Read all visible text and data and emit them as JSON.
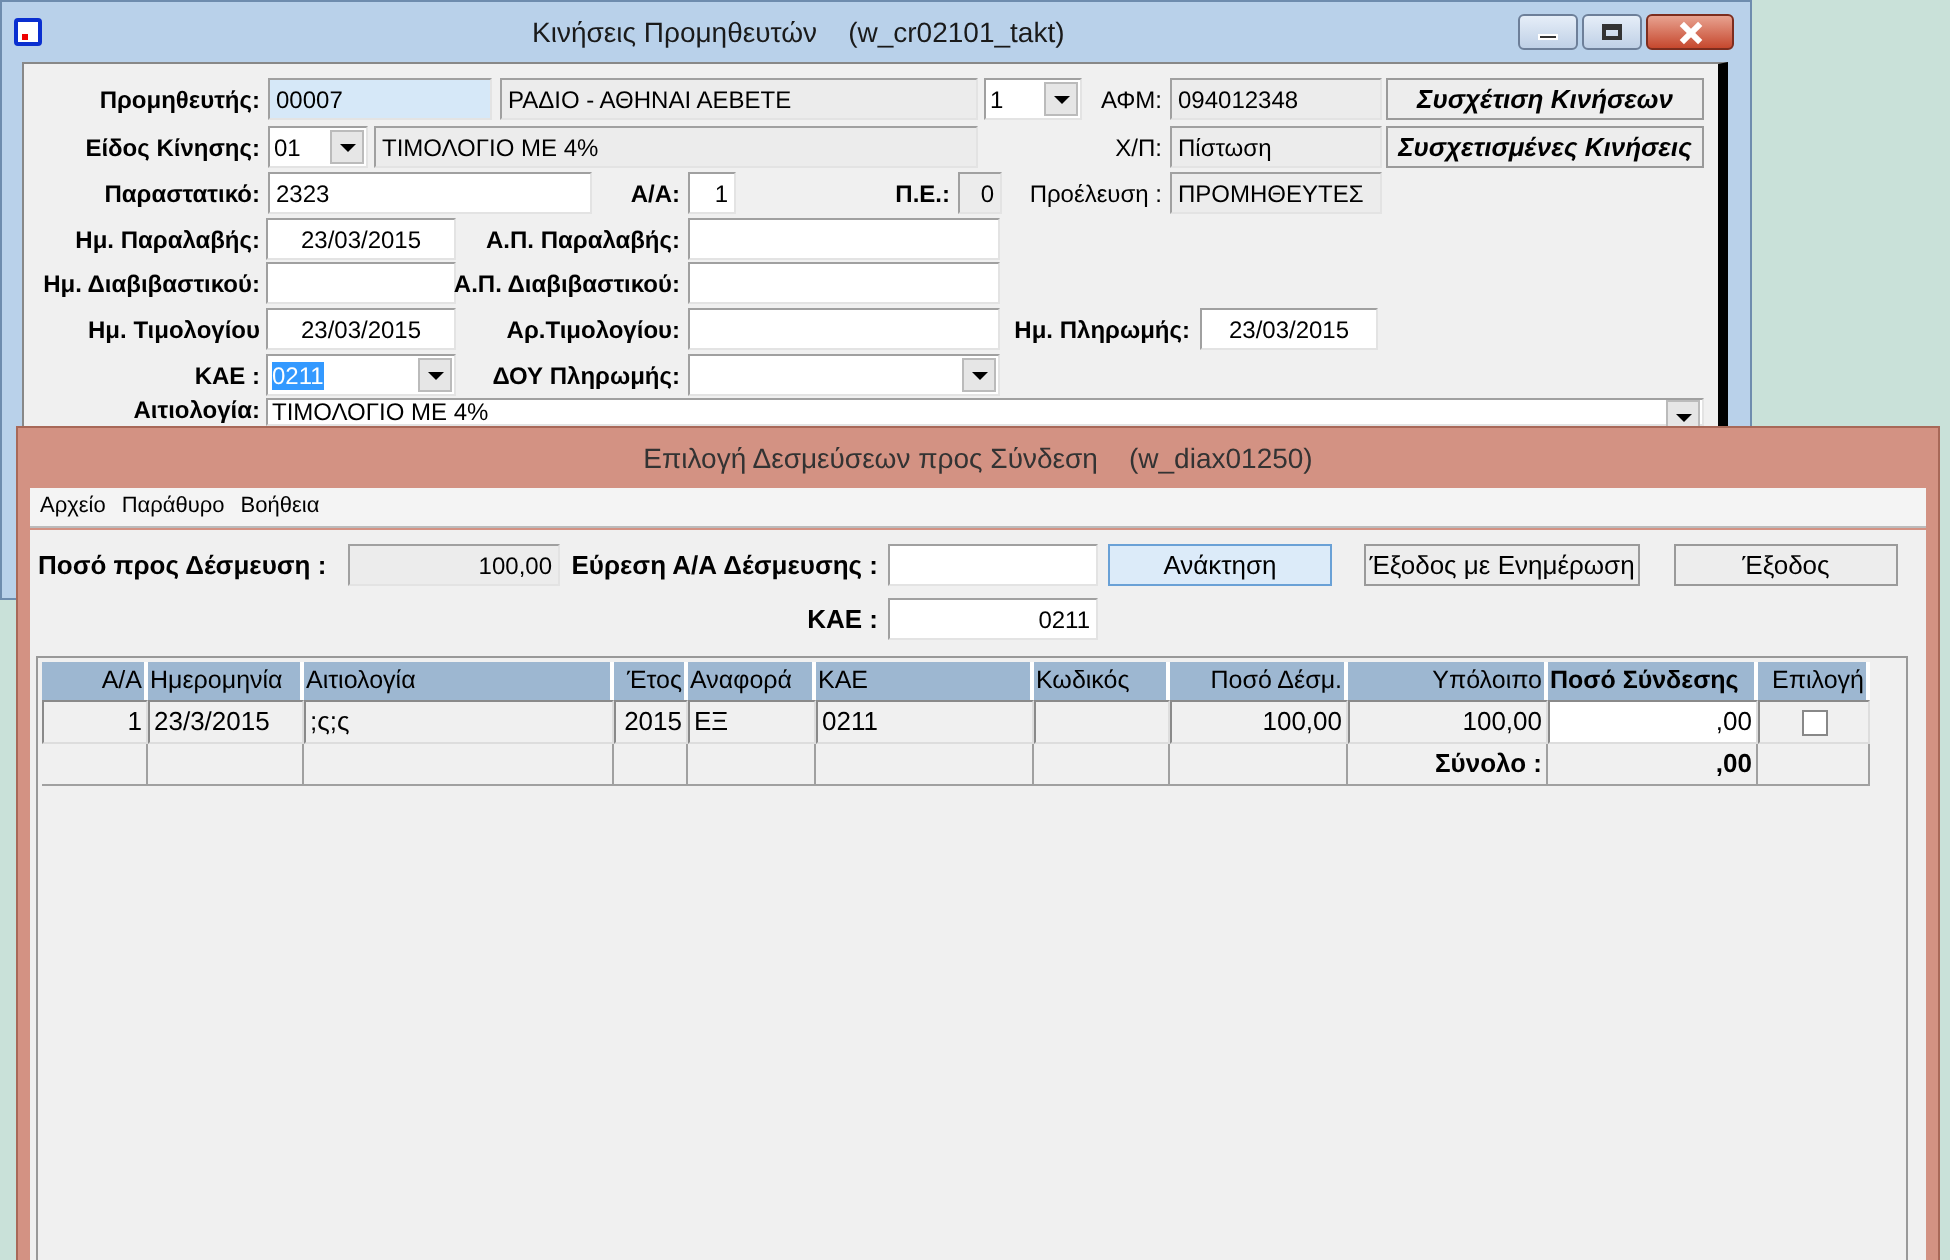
{
  "main_window": {
    "title": "Κινήσεις Προμηθευτών    (w_cr02101_takt)",
    "fields": [
      {
        "kind": "label",
        "text": "Προμηθευτής:",
        "bold": true
      },
      {
        "kind": "field",
        "value": "00007",
        "readonly": false,
        "focused": true
      },
      {
        "kind": "field",
        "value": "ΡΑΔΙΟ - ΑΘΗΝΑΙ ΑΕΒΕΤΕ",
        "readonly": true,
        "focused": false
      },
      {
        "kind": "combo",
        "value": "1",
        "text_selected": false
      },
      {
        "kind": "label",
        "text": "ΑΦΜ:",
        "bold": false
      },
      {
        "kind": "field",
        "value": "094012348",
        "readonly": true,
        "focused": false
      },
      {
        "kind": "button",
        "label": "Συσχέτιση Κινήσεων",
        "default": false
      },
      {
        "kind": "label",
        "text": "Είδος Κίνησης:",
        "bold": true
      },
      {
        "kind": "combo",
        "value": "01",
        "text_selected": false
      },
      {
        "kind": "field",
        "value": "ΤΙΜΟΛΟΓΙΟ ΜΕ 4%",
        "readonly": true,
        "focused": false
      },
      {
        "kind": "label",
        "text": "Χ/Π:",
        "bold": false
      },
      {
        "kind": "field",
        "value": "Πίστωση",
        "readonly": true,
        "focused": false
      },
      {
        "kind": "button",
        "label": "Συσχετισμένες Κινήσεις",
        "default": false
      },
      {
        "kind": "label",
        "text": "Παραστατικό:",
        "bold": true
      },
      {
        "kind": "field",
        "value": "2323",
        "readonly": false,
        "focused": false
      },
      {
        "kind": "label",
        "text": "Α/Α:",
        "bold": true
      },
      {
        "kind": "field",
        "value": "1",
        "readonly": false,
        "focused": false
      },
      {
        "kind": "label",
        "text": "Π.Ε.:",
        "bold": true
      },
      {
        "kind": "field",
        "value": "0",
        "readonly": true,
        "focused": false
      },
      {
        "kind": "label",
        "text": "Προέλευση :",
        "bold": false
      },
      {
        "kind": "field",
        "value": "ΠΡΟΜΗΘΕΥΤΕΣ",
        "readonly": true,
        "focused": false
      },
      {
        "kind": "label",
        "text": "Ημ. Παραλαβής:",
        "bold": true
      },
      {
        "kind": "field",
        "value": "23/03/2015",
        "readonly": false,
        "focused": false
      },
      {
        "kind": "label",
        "text": "Α.Π. Παραλαβής:",
        "bold": true
      },
      {
        "kind": "field",
        "readonly": false,
        "focused": false
      },
      {
        "kind": "label",
        "text": "Ημ. Διαβιβαστικού:",
        "bold": true
      },
      {
        "kind": "field",
        "readonly": false,
        "focused": false
      },
      {
        "kind": "label",
        "text": "Α.Π. Διαβιβαστικού:",
        "bold": true
      },
      {
        "kind": "field",
        "readonly": false,
        "focused": false
      },
      {
        "kind": "label",
        "text": "Ημ. Τιμολογίου",
        "bold": true
      },
      {
        "kind": "field",
        "value": "23/03/2015",
        "readonly": false,
        "focused": false
      },
      {
        "kind": "label",
        "text": "Αρ.Τιμολογίου:",
        "bold": true
      },
      {
        "kind": "field",
        "readonly": false,
        "focused": false
      },
      {
        "kind": "label",
        "text": "Ημ. Πληρωμής:",
        "bold": true
      },
      {
        "kind": "field",
        "value": "23/03/2015",
        "readonly": false,
        "focused": false
      },
      {
        "kind": "label",
        "text": "ΚΑΕ :",
        "bold": true
      },
      {
        "kind": "combo",
        "value": "0211",
        "text_selected": true
      },
      {
        "kind": "label",
        "text": "ΔΟΥ Πληρωμής:",
        "bold": true
      },
      {
        "kind": "combo"
      },
      {
        "kind": "label",
        "text": "Αιτιολογία:",
        "bold": true
      },
      {
        "kind": "combo",
        "value": "ΤΙΜΟΛΟΓΙΟ ΜΕ 4%",
        "text_selected": false
      }
    ]
  },
  "dialog": {
    "title": "Επιλογή Δεσμεύσεων προς Σύνδεση    (w_diax01250)",
    "menu": [
      "Αρχείο",
      "Παράθυρο",
      "Βοήθεια"
    ],
    "fields": [
      {
        "kind": "label",
        "text": "Ποσό προς Δέσμευση :",
        "bold": true
      },
      {
        "kind": "field",
        "value": "100,00",
        "readonly": true,
        "focused": false
      },
      {
        "kind": "label",
        "text": "Εύρεση Α/Α Δέσμευσης :",
        "bold": true
      },
      {
        "kind": "field",
        "readonly": false,
        "focused": false
      },
      {
        "kind": "button",
        "label": "Ανάκτηση",
        "default": true
      },
      {
        "kind": "button",
        "label": "Έξοδος με Ενημέρωση",
        "default": false
      },
      {
        "kind": "button",
        "label": "Έξοδος",
        "default": false
      },
      {
        "kind": "label",
        "text": "ΚΑΕ :",
        "bold": true
      },
      {
        "kind": "field",
        "value": "0211",
        "readonly": false,
        "focused": false
      }
    ],
    "table": {
      "columns": [
        {
          "label": "Α/Α",
          "bold": false
        },
        {
          "label": "Ημερομηνία",
          "bold": false
        },
        {
          "label": "Αιτιολογία",
          "bold": false
        },
        {
          "label": "Έτος",
          "bold": false
        },
        {
          "label": "Αναφορά",
          "bold": false
        },
        {
          "label": "ΚΑΕ",
          "bold": false
        },
        {
          "label": "Κωδικός",
          "bold": false
        },
        {
          "label": "Ποσό Δέσμ.",
          "bold": false
        },
        {
          "label": "Υπόλοιπο",
          "bold": false
        },
        {
          "label": "Ποσό Σύνδεσης",
          "bold": true
        },
        {
          "label": "Επιλογή",
          "bold": false
        }
      ],
      "rows": [
        {
          "cells": [
            "1",
            "23/3/2015",
            ";ς;ς",
            "2015",
            "ΕΞ",
            "0211",
            null,
            "100,00",
            "100,00",
            ",00"
          ],
          "checked": false
        }
      ],
      "total": {
        "label": "Σύνολο :",
        "value": ",00"
      }
    }
  }
}
